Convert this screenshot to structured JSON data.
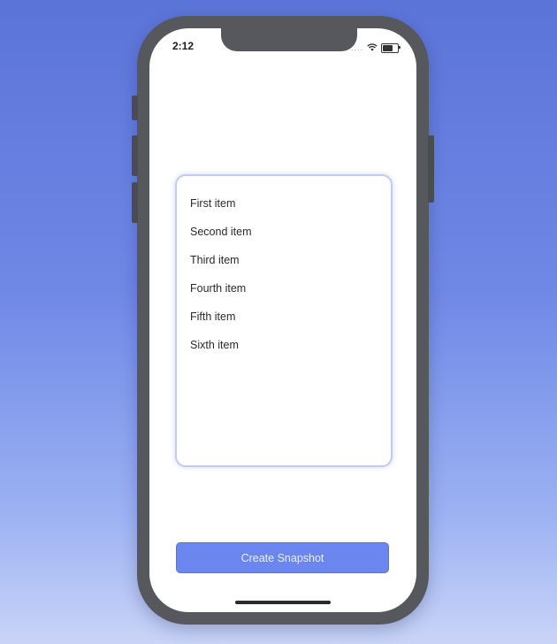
{
  "status_bar": {
    "time": "2:12",
    "signal": "....",
    "icons": [
      "wifi-icon",
      "battery-icon"
    ]
  },
  "list": {
    "items": [
      {
        "label": "First item"
      },
      {
        "label": "Second item"
      },
      {
        "label": "Third item"
      },
      {
        "label": "Fourth item"
      },
      {
        "label": "Fifth item"
      },
      {
        "label": "Sixth item"
      }
    ]
  },
  "actions": {
    "create_snapshot_label": "Create Snapshot"
  },
  "colors": {
    "background_top": "#5b74d8",
    "background_bottom": "#c9d4f6",
    "phone_frame": "#56585e",
    "button_accent": "#6b86ee",
    "card_border": "#c3cbf0"
  }
}
